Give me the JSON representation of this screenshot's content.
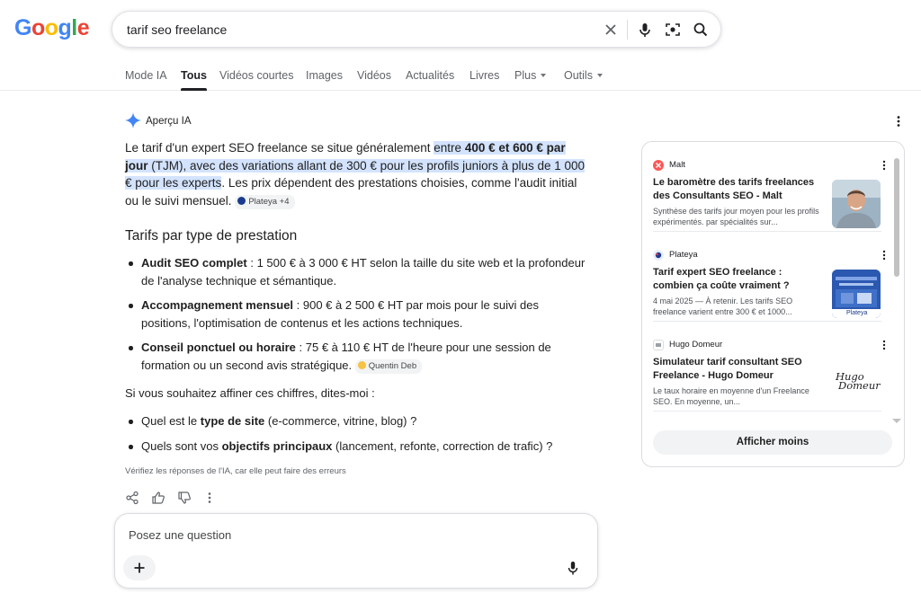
{
  "search": {
    "query": "tarif seo freelance"
  },
  "tabs": [
    {
      "label": "Mode IA"
    },
    {
      "label": "Tous"
    },
    {
      "label": "Vidéos courtes"
    },
    {
      "label": "Images"
    },
    {
      "label": "Vidéos"
    },
    {
      "label": "Actualités"
    },
    {
      "label": "Livres"
    },
    {
      "label": "Plus"
    },
    {
      "label": "Outils"
    }
  ],
  "ai_overview": {
    "title": "Aperçu IA",
    "intro_before": "Le tarif d'un expert SEO freelance se situe généralement ",
    "intro_hl_1": "entre ",
    "intro_hl_bold_1": "400 € et 600 € par jour",
    "intro_hl_2": " (TJM), avec des variations allant de 300 € pour les profils juniors à plus de 1 000 € pour les experts",
    "intro_after": ". Les prix dépendent des prestations choisies, comme l'audit initial ou le suivi mensuel.",
    "intro_chip": "Plateya +4",
    "section_title": "Tarifs par type de prestation",
    "bullets": [
      {
        "bold": "Audit SEO complet",
        "text": " : 1 500 € à 3 000 € HT selon la taille du site web et la profondeur de l'analyse technique et sémantique."
      },
      {
        "bold": "Accompagnement mensuel",
        "text": " : 900 € à 2 500 € HT par mois pour le suivi des positions, l'optimisation de contenus et les actions techniques."
      },
      {
        "bold": "Conseil ponctuel ou horaire",
        "text": " : 75 € à 110 € HT de l'heure pour une session de formation ou un second avis stratégique.",
        "chip": "Quentin Deb"
      }
    ],
    "follow_up": "Si vous souhaitez affiner ces chiffres, dites-moi :",
    "questions": [
      {
        "before": "Quel est le ",
        "bold": "type de site",
        "after": " (e-commerce, vitrine, blog) ?"
      },
      {
        "before": "Quels sont vos ",
        "bold": "objectifs principaux",
        "after": " (lancement, refonte, correction de trafic) ?"
      }
    ],
    "disclaimer": "Vérifiez les réponses de l'IA, car elle peut faire des erreurs",
    "ask_placeholder": "Posez une question"
  },
  "sources": {
    "cards": [
      {
        "source": "Malt",
        "title": "Le baromètre des tarifs freelances des Consultants SEO - Malt",
        "desc": "Synthèse des tarifs jour moyen pour les profils expérimentés. par spécialités sur..."
      },
      {
        "source": "Plateya",
        "title": "Tarif expert SEO freelance : combien ça coûte vraiment ?",
        "desc": "4 mai 2025 — À retenir. Les tarifs SEO freelance varient entre 300 € et 1000...",
        "thumb_label": "Plateya"
      },
      {
        "source": "Hugo Domeur",
        "title": "Simulateur tarif consultant SEO Freelance - Hugo Domeur",
        "desc": "Le taux horaire en moyenne d'un Freelance SEO. En moyenne, un...",
        "thumb_line1": "Hugo",
        "thumb_line2": "Domeur"
      }
    ],
    "show_less": "Afficher moins"
  },
  "colors": {
    "highlight": "#d3e3fd",
    "malt": "#fc5757",
    "plateya": "#1a3a8f"
  }
}
